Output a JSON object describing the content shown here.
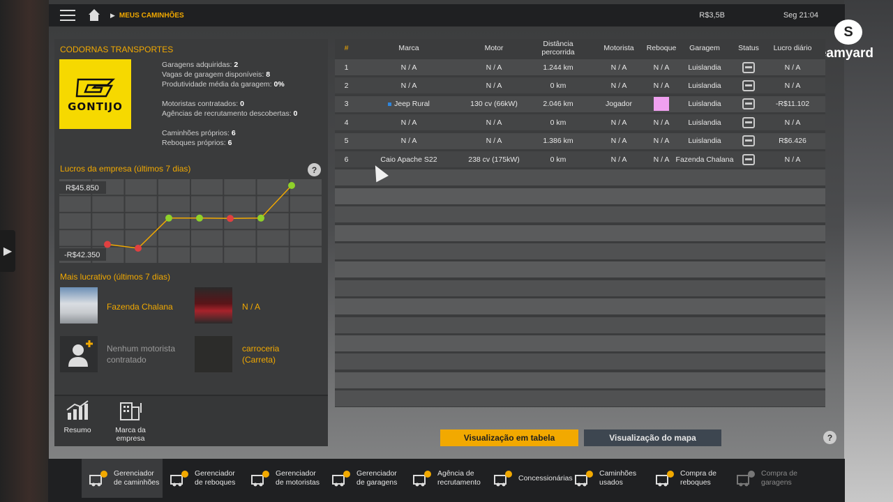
{
  "topbar": {
    "breadcrumb": "MEUS CAMINHÕES",
    "money": "R$3,5B",
    "clock": "Seg 21:04"
  },
  "watermark": {
    "text": "streamyard"
  },
  "company": {
    "name": "CODORNAS TRANSPORTES",
    "logo_text": "GONTIJO",
    "stats": [
      {
        "label": "Garagens adquiridas:",
        "value": "2"
      },
      {
        "label": "Vagas de garagem disponíveis:",
        "value": "8"
      },
      {
        "label": "Produtividade média da garagem:",
        "value": "0%"
      },
      {
        "label": "Motoristas contratados:",
        "value": "0"
      },
      {
        "label": "Agências de recrutamento descobertas:",
        "value": "0"
      },
      {
        "label": "Caminhões próprios:",
        "value": "6"
      },
      {
        "label": "Reboques próprios:",
        "value": "6"
      }
    ]
  },
  "profit_chart": {
    "title": "Lucros da empresa (últimos 7 dias)",
    "help": "?",
    "max_label": "R$45.850",
    "min_label": "-R$42.350"
  },
  "chart_data": {
    "type": "line",
    "title": "Lucros da empresa (últimos 7 dias)",
    "x": [
      1,
      2,
      3,
      4,
      5,
      6,
      7
    ],
    "values": [
      -37000,
      -42350,
      0,
      0,
      -500,
      0,
      45850
    ],
    "point_colors": [
      "#e04040",
      "#e04040",
      "#8fd12a",
      "#8fd12a",
      "#e04040",
      "#8fd12a",
      "#8fd12a"
    ],
    "line_color": "#f2a900",
    "ylim": [
      -42350,
      45850
    ],
    "grid": true
  },
  "best": {
    "title": "Mais lucrativo (últimos 7 dias)",
    "garage": "Fazenda Chalana",
    "truck": "N / A",
    "driver": "Nenhum motorista contratado",
    "cargo": "carroceria (Carreta)"
  },
  "tools": {
    "summary": "Resumo",
    "brand": "Marca da empresa"
  },
  "table": {
    "headers": [
      "#",
      "Marca",
      "Motor",
      "Distância percorrida",
      "Motorista",
      "Reboque",
      "Garagem",
      "Status",
      "Lucro diário"
    ],
    "rows": [
      {
        "n": "1",
        "marca": "N / A",
        "motor": "N / A",
        "dist": "1.244 km",
        "motorista": "N / A",
        "reboque": "N / A",
        "garagem": "Luislandia",
        "lucro": "N / A"
      },
      {
        "n": "2",
        "marca": "N / A",
        "motor": "N / A",
        "dist": "0 km",
        "motorista": "N / A",
        "reboque": "N / A",
        "garagem": "Luislandia",
        "lucro": "N / A"
      },
      {
        "n": "3",
        "marca": "Jeep Rural",
        "motor": "130 cv (66kW)",
        "dist": "2.046 km",
        "motorista": "Jogador",
        "reboque": "",
        "garagem": "Luislandia",
        "lucro": "-R$11.102"
      },
      {
        "n": "4",
        "marca": "N / A",
        "motor": "N / A",
        "dist": "0 km",
        "motorista": "N / A",
        "reboque": "N / A",
        "garagem": "Luislandia",
        "lucro": "N / A"
      },
      {
        "n": "5",
        "marca": "N / A",
        "motor": "N / A",
        "dist": "1.386 km",
        "motorista": "N / A",
        "reboque": "N / A",
        "garagem": "Luislandia",
        "lucro": "R$6.426"
      },
      {
        "n": "6",
        "marca": "Caio Apache S22",
        "motor": "238 cv (175kW)",
        "dist": "0 km",
        "motorista": "N / A",
        "reboque": "N / A",
        "garagem": "Fazenda Chalana",
        "lucro": "N / A"
      }
    ]
  },
  "views": {
    "table": "Visualização em tabela",
    "map": "Visualização do mapa"
  },
  "nav": [
    {
      "label": "Gerenciador de caminhões",
      "active": true
    },
    {
      "label": "Gerenciador de reboques"
    },
    {
      "label": "Gerenciador de motoristas"
    },
    {
      "label": "Gerenciador de garagens"
    },
    {
      "label": "Agência de recrutamento"
    },
    {
      "label": "Concessionárias"
    },
    {
      "label": "Caminhões usados"
    },
    {
      "label": "Compra de reboques"
    },
    {
      "label": "Compra de garagens",
      "disabled": true
    }
  ]
}
